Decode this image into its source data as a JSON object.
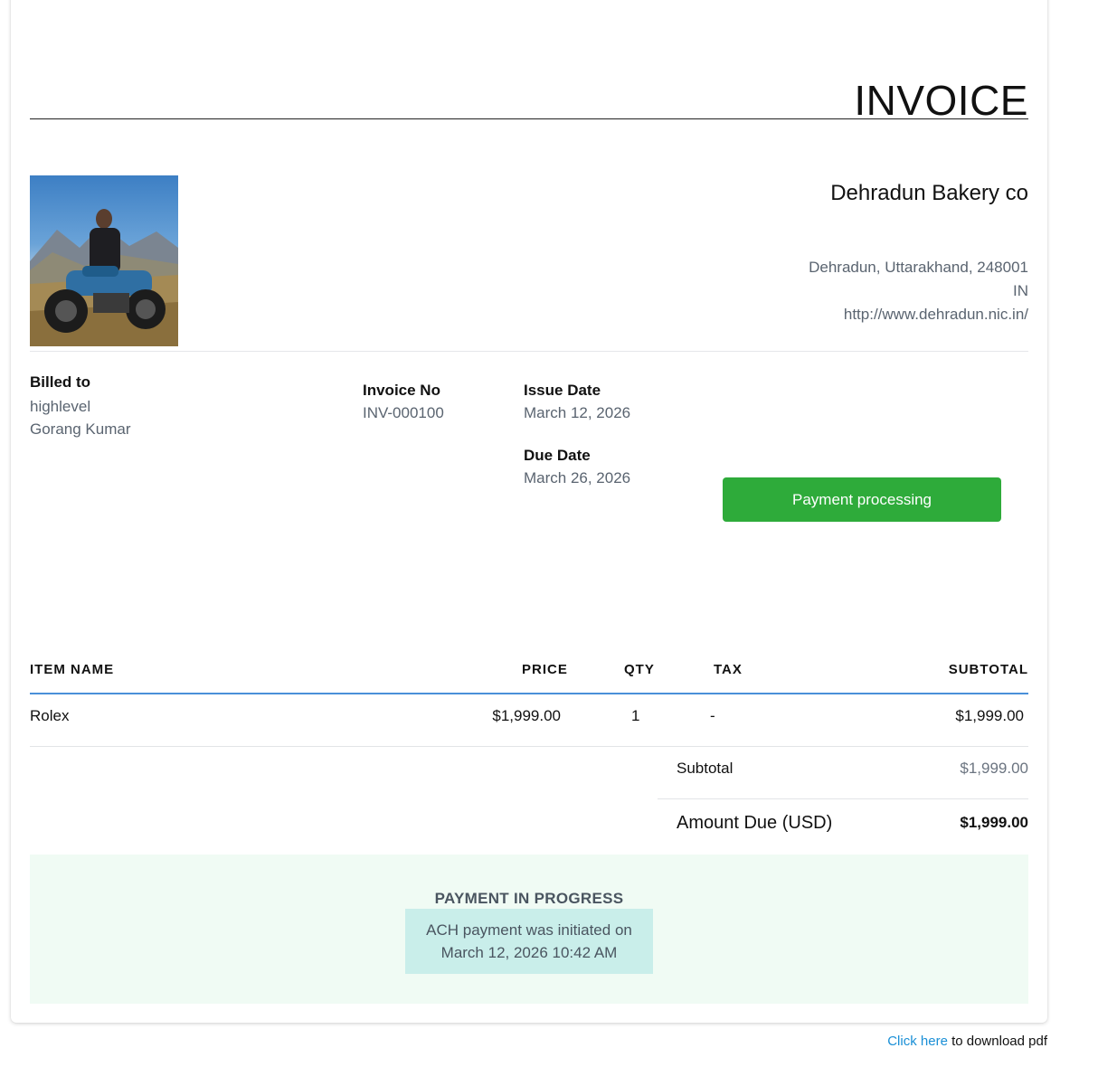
{
  "invoice": {
    "title": "INVOICE"
  },
  "company": {
    "name": "Dehradun Bakery co",
    "address_line": "Dehradun, Uttarakhand, 248001",
    "country": "IN",
    "website": "http://www.dehradun.nic.in/"
  },
  "billing": {
    "billed_to_label": "Billed to",
    "customer_org": "highlevel",
    "customer_name": "Gorang Kumar",
    "invoice_no_label": "Invoice No",
    "invoice_no": "INV-000100",
    "issue_date_label": "Issue Date",
    "issue_date": "March 12, 2026",
    "due_date_label": "Due Date",
    "due_date": "March 26, 2026"
  },
  "status": {
    "button_label": "Payment processing",
    "color": "#2eab3a"
  },
  "table": {
    "headers": {
      "item": "ITEM NAME",
      "price": "PRICE",
      "qty": "QTY",
      "tax": "TAX",
      "subtotal": "SUBTOTAL"
    },
    "rows": [
      {
        "item": "Rolex",
        "price": "$1,999.00",
        "qty": "1",
        "tax": "-",
        "subtotal": "$1,999.00"
      }
    ]
  },
  "totals": {
    "subtotal_label": "Subtotal",
    "subtotal_value": "$1,999.00",
    "amount_due_label": "Amount Due (USD)",
    "amount_due_value": "$1,999.00"
  },
  "banner": {
    "title": "PAYMENT IN PROGRESS",
    "message_line1": "ACH payment was initiated on",
    "message_line2": "March 12, 2026 10:42 AM"
  },
  "footer": {
    "link_text": "Click here",
    "suffix": " to download pdf"
  },
  "colors": {
    "accent_rule": "#4a90d9",
    "link": "#1a8fd6",
    "banner_bg": "#f0fbf4",
    "banner_msg_bg": "#c9eeea"
  }
}
